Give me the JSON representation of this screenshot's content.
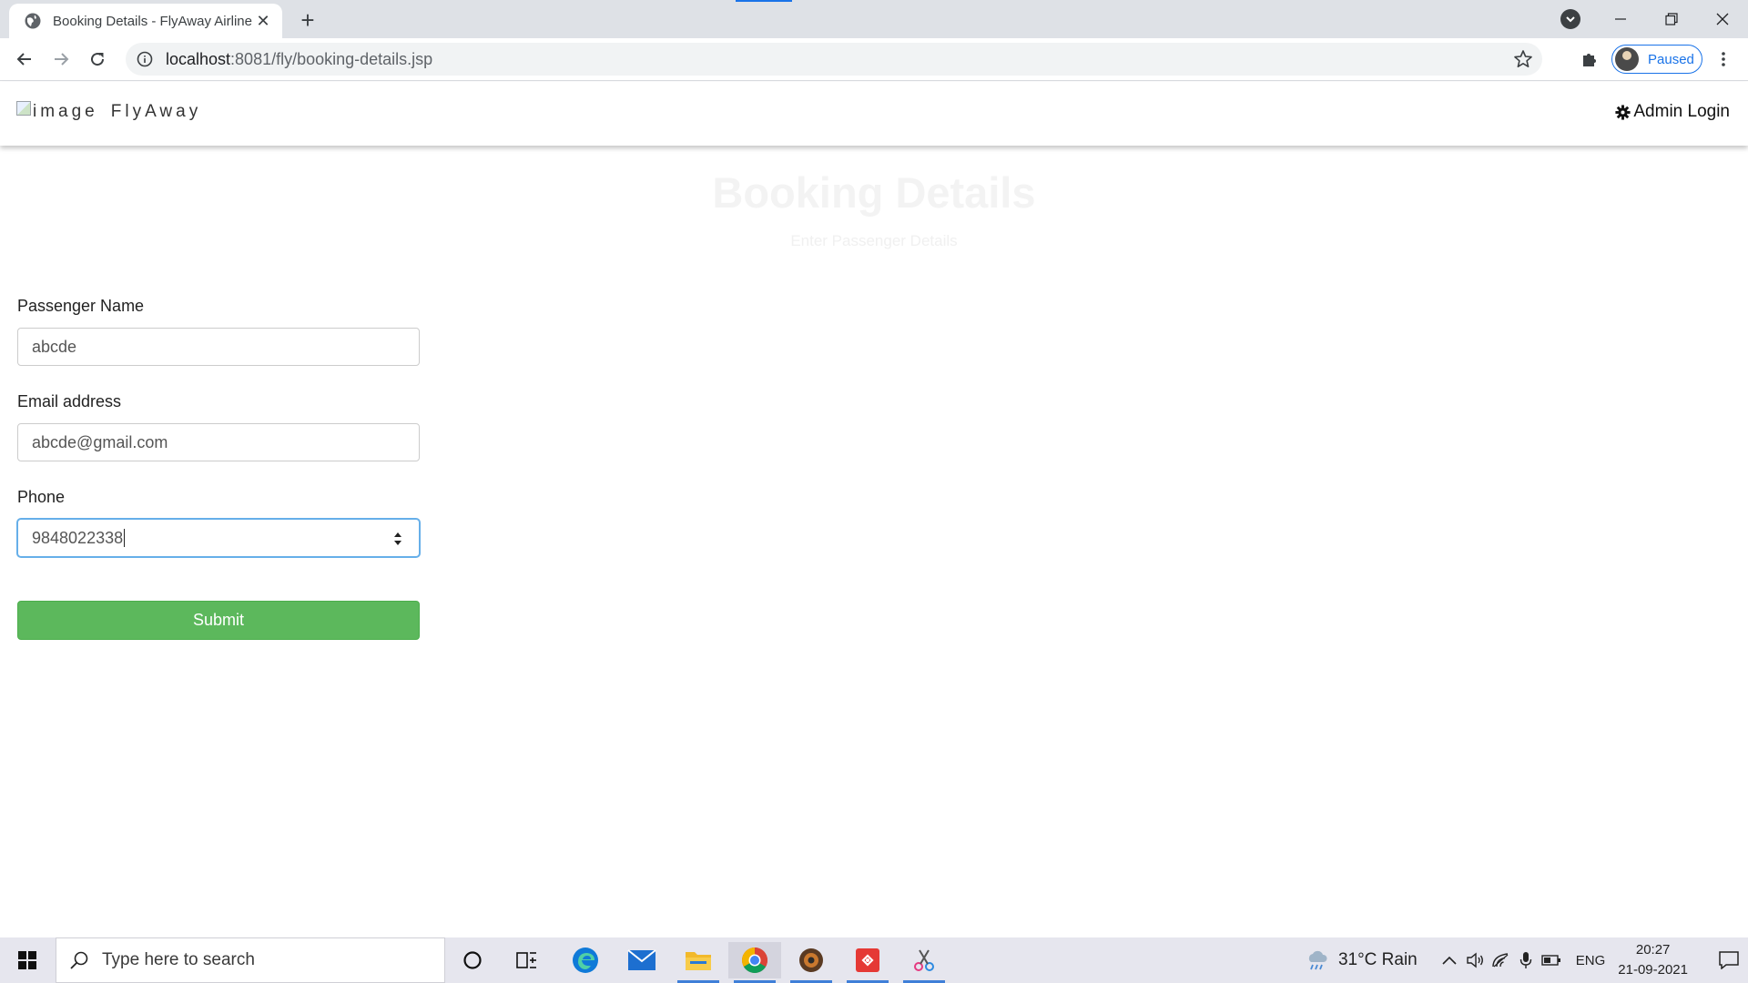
{
  "browser": {
    "tab_title": "Booking Details - FlyAway Airline",
    "url_host": "localhost",
    "url_path": ":8081/fly/booking-details.jsp",
    "profile_status": "Paused",
    "accent": "#1a73e8"
  },
  "nav": {
    "brand_alt": "image",
    "brand_text": "FlyAway",
    "admin_login": "Admin Login"
  },
  "header": {
    "title": "Booking Details",
    "subtitle": "Enter Passenger Details"
  },
  "form": {
    "name_label": "Passenger Name",
    "name_value": "abcde",
    "email_label": "Email address",
    "email_value": "abcde@gmail.com",
    "phone_label": "Phone",
    "phone_value": "9848022338",
    "submit_label": "Submit",
    "submit_color": "#5cb85c"
  },
  "taskbar": {
    "search_placeholder": "Type here to search",
    "weather": "31°C  Rain",
    "language": "ENG",
    "time": "20:27",
    "date": "21-09-2021",
    "icons": [
      "cortana-icon",
      "task-view-icon",
      "edge-icon",
      "mail-icon",
      "file-explorer-icon",
      "chrome-icon",
      "app-icon",
      "git-icon",
      "snipping-tool-icon"
    ]
  }
}
